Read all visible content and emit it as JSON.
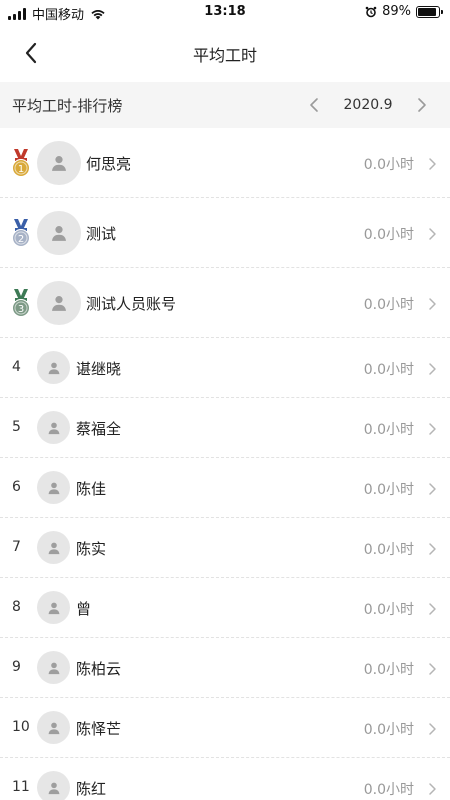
{
  "status": {
    "carrier": "中国移动",
    "time": "13:18",
    "battery": "89%",
    "battery_level": 0.89
  },
  "nav": {
    "title": "平均工时",
    "back_icon": "chevron-left-icon"
  },
  "section": {
    "title": "平均工时-排行榜",
    "month": "2020.9"
  },
  "ranking": [
    {
      "rank": "1",
      "medal": "gold",
      "name": "何思亮",
      "hours": "0.0小时"
    },
    {
      "rank": "2",
      "medal": "silver",
      "name": "测试",
      "hours": "0.0小时"
    },
    {
      "rank": "3",
      "medal": "bronze",
      "name": "测试人员账号",
      "hours": "0.0小时"
    },
    {
      "rank": "4",
      "name": "谌继晓",
      "hours": "0.0小时"
    },
    {
      "rank": "5",
      "name": "蔡福全",
      "hours": "0.0小时"
    },
    {
      "rank": "6",
      "name": "陈佳",
      "hours": "0.0小时"
    },
    {
      "rank": "7",
      "name": "陈实",
      "hours": "0.0小时"
    },
    {
      "rank": "8",
      "name": "曾",
      "hours": "0.0小时"
    },
    {
      "rank": "9",
      "name": "陈柏云",
      "hours": "0.0小时"
    },
    {
      "rank": "10",
      "name": "陈怿芒",
      "hours": "0.0小时"
    },
    {
      "rank": "11",
      "name": "陈红",
      "hours": "0.0小时"
    }
  ],
  "colors": {
    "gold": "#d9a93a",
    "silver": "#a7b2c6",
    "bronze": "#7d9a86",
    "ribbon_red": "#c0392b",
    "ribbon_blue": "#3a5fa8",
    "ribbon_green": "#3d7a55"
  }
}
